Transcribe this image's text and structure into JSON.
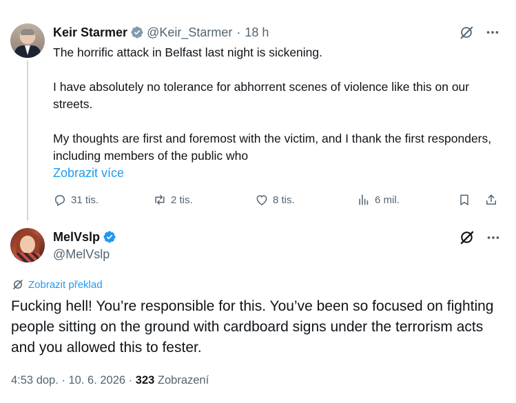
{
  "parent_tweet": {
    "author_name": "Keir Starmer",
    "handle": "@Keir_Starmer",
    "separator": "·",
    "time": "18 h",
    "paragraphs": [
      "The horrific attack in Belfast last night is sickening.",
      "I have absolutely no tolerance for abhorrent scenes of violence like this on our streets.",
      "My thoughts are first and foremost with the victim, and I thank the first responders, including members of the public who"
    ],
    "show_more": "Zobrazit více",
    "actions": {
      "replies": "31 tis.",
      "reposts": "2 tis.",
      "likes": "8 tis.",
      "views": "6 mil."
    }
  },
  "reply_tweet": {
    "author_name": "MelVslp",
    "handle": "@MelVslp",
    "translate_label": "Zobrazit překlad",
    "text": "Fucking hell! You’re responsible for this. You’ve been so focused on fighting people sitting on the ground with cardboard signs under the terrorism acts and you allowed this to fester.",
    "time": "4:53 dop.",
    "separator": "·",
    "date": "10. 6. 2026",
    "views_count": "323",
    "views_label": "Zobrazení"
  },
  "icons": {
    "verified": "verified-badge-icon",
    "grok": "grok-icon",
    "more": "more-icon",
    "reply": "reply-icon",
    "repost": "repost-icon",
    "like": "like-icon",
    "views": "views-icon",
    "bookmark": "bookmark-icon",
    "share": "share-icon",
    "translate": "translate-icon"
  },
  "colors": {
    "accent": "#1d9bf0",
    "text_primary": "#0f1419",
    "text_secondary": "#536471",
    "thread_line": "#cfd9de"
  }
}
